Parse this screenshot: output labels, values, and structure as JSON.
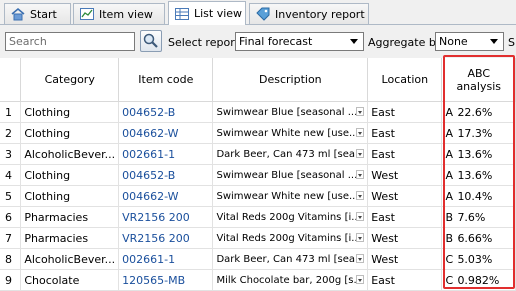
{
  "tabs": [
    {
      "label": "Start",
      "icon": "home-icon"
    },
    {
      "label": "Item view",
      "icon": "chart-icon"
    },
    {
      "label": "List view",
      "icon": "table-icon"
    },
    {
      "label": "Inventory report",
      "icon": "tag-icon"
    }
  ],
  "toolbar": {
    "search_placeholder": "Search",
    "select_report_label": "Select report",
    "select_report_value": "Final forecast",
    "aggregate_label": "Aggregate by",
    "aggregate_value": "None",
    "trailing_label": "S"
  },
  "table": {
    "headers": {
      "category": "Category",
      "item_code": "Item code",
      "description": "Description",
      "location": "Location",
      "abc": "ABC analysis"
    },
    "rows": [
      {
        "n": "1",
        "category": "Clothing",
        "code": "004652-B",
        "desc": "Swimwear Blue [seasonal ...",
        "location": "East",
        "cls": "A",
        "pct": "22.6%"
      },
      {
        "n": "2",
        "category": "Clothing",
        "code": "004662-W",
        "desc": "Swimwear White new [use...",
        "location": "East",
        "cls": "A",
        "pct": "17.3%"
      },
      {
        "n": "3",
        "category": "AlcoholicBever...",
        "code": "002661-1",
        "desc": "Dark Beer, Can 473 ml [sea...",
        "location": "East",
        "cls": "A",
        "pct": "13.6%"
      },
      {
        "n": "4",
        "category": "Clothing",
        "code": "004652-B",
        "desc": "Swimwear Blue [seasonal ...",
        "location": "West",
        "cls": "A",
        "pct": "13.6%"
      },
      {
        "n": "5",
        "category": "Clothing",
        "code": "004662-W",
        "desc": "Swimwear White new [use...",
        "location": "West",
        "cls": "A",
        "pct": "10.4%"
      },
      {
        "n": "6",
        "category": "Pharmacies",
        "code": "VR2156 200",
        "desc": "Vital Reds 200g Vitamins [i...",
        "location": "East",
        "cls": "B",
        "pct": "7.6%"
      },
      {
        "n": "7",
        "category": "Pharmacies",
        "code": "VR2156 200",
        "desc": "Vital Reds 200g Vitamins [i...",
        "location": "West",
        "cls": "B",
        "pct": "6.66%"
      },
      {
        "n": "8",
        "category": "AlcoholicBever...",
        "code": "002661-1",
        "desc": "Dark Beer, Can 473 ml [sea...",
        "location": "West",
        "cls": "C",
        "pct": "5.03%"
      },
      {
        "n": "9",
        "category": "Chocolate",
        "code": "120565-MB",
        "desc": "Milk Chocolate bar, 200g [s...",
        "location": "East",
        "cls": "C",
        "pct": "0.982%"
      }
    ]
  },
  "colors": {
    "highlight": "#e12e2e",
    "link": "#1a4f9c"
  }
}
